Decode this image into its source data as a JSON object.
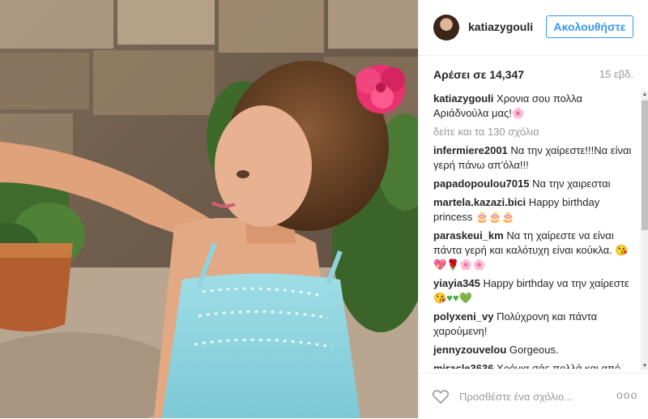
{
  "post": {
    "username": "katiazygouli",
    "follow_label": "Ακολουθήστε",
    "likes": "Αρέσει σε 14,347",
    "age": "15 εβδ.",
    "caption_user": "katiazygouli",
    "caption_text": "Χρονια σου πολλα Αριάδνούλα μας!",
    "caption_emoji": "🌸",
    "view_all": "δείτε και τα 130 σχόλια"
  },
  "comments": [
    {
      "user": "infermiere2001",
      "text": "Να την χαίρεστε!!!Να είναι γερή πάνω απ'όλα!!!"
    },
    {
      "user": "papadopoulou7015",
      "text": "Να την χαιρεσται"
    },
    {
      "user": "martela.kazazi.bici",
      "text": "Happy birthday princess",
      "emoji": "🎂🎂🎂"
    },
    {
      "user": "paraskeui_km",
      "text": "Να τη χαίρεστε να είναι πάντα γερή και καλότυχη είναι κούκλα.",
      "emoji": "😘💖🌹🌸🌸"
    },
    {
      "user": "yiayia345",
      "text": "Happy birthday να την χαίρεστε",
      "emoji": "😘♥♥💚"
    },
    {
      "user": "polyxeni_vy",
      "text": "Πολύχρονη και πάντα χαρούμενη!"
    },
    {
      "user": "jennyzouvelou",
      "text": "Gorgeous."
    },
    {
      "user": "miracle3636",
      "text": "Χρόνια σάς πολλά και από την ΡΩΣΙΑ,πολύχρονη και ευτυχίζμενη"
    }
  ],
  "footer": {
    "placeholder": "Προσθέστε ένα σχόλιο...",
    "more": "ooo"
  },
  "icons": {
    "heart": "heart-icon",
    "more": "more-options-icon"
  },
  "colors": {
    "accent": "#3897f0",
    "muted": "#999999",
    "text": "#262626"
  }
}
